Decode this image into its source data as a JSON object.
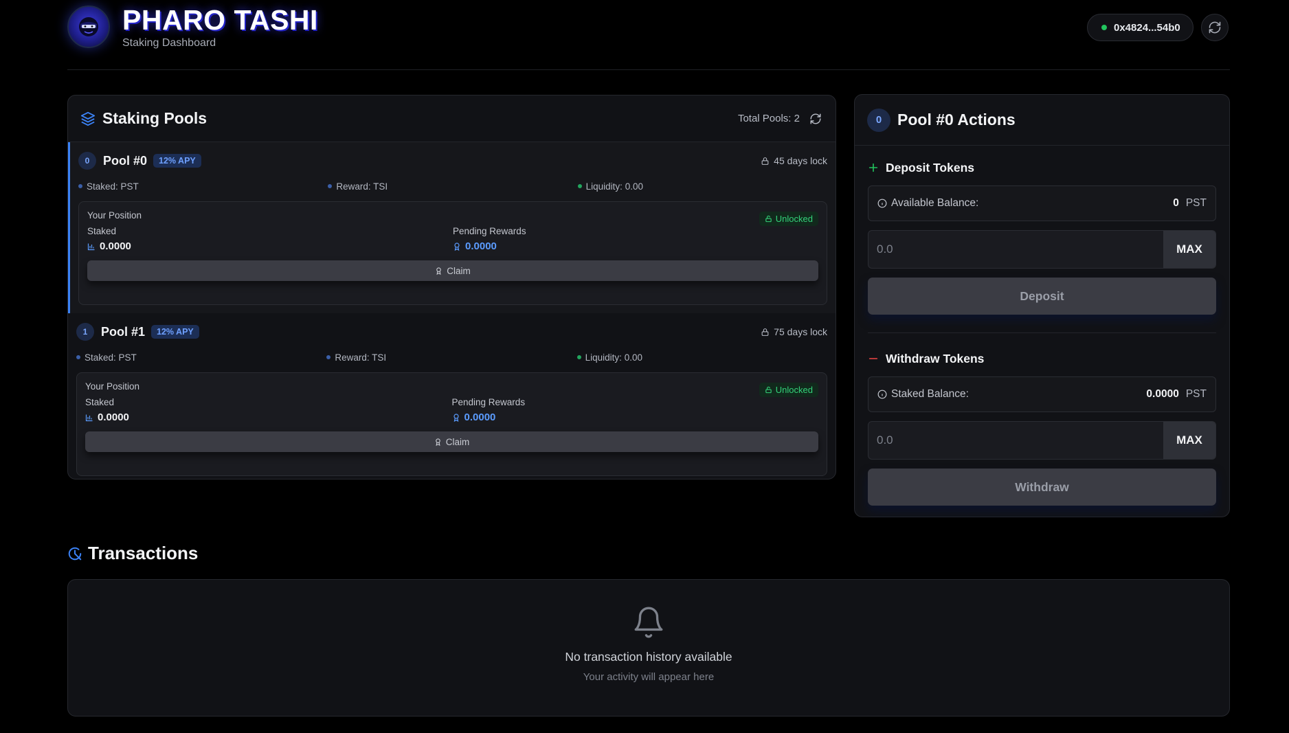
{
  "header": {
    "title": "PHARO TASHI",
    "subtitle": "Staking Dashboard",
    "wallet_address": "0x4824...54b0"
  },
  "pools_panel": {
    "title": "Staking Pools",
    "total_pools_label": "Total Pools: 2",
    "pools": [
      {
        "number": "0",
        "name": "Pool #0",
        "apy": "12% APY",
        "lock": "45 days lock",
        "staked_token": "Staked: PST",
        "reward_token": "Reward: TSI",
        "liquidity": "Liquidity: 0.00",
        "position_label": "Your Position",
        "status": "Unlocked",
        "staked_label": "Staked",
        "staked_value": "0.0000",
        "pending_label": "Pending Rewards",
        "pending_value": "0.0000",
        "claim_label": "Claim"
      },
      {
        "number": "1",
        "name": "Pool #1",
        "apy": "12% APY",
        "lock": "75 days lock",
        "staked_token": "Staked: PST",
        "reward_token": "Reward: TSI",
        "liquidity": "Liquidity: 0.00",
        "position_label": "Your Position",
        "status": "Unlocked",
        "staked_label": "Staked",
        "staked_value": "0.0000",
        "pending_label": "Pending Rewards",
        "pending_value": "0.0000",
        "claim_label": "Claim"
      }
    ]
  },
  "actions_panel": {
    "number": "0",
    "title": "Pool #0 Actions",
    "deposit": {
      "title": "Deposit Tokens",
      "balance_label": "Available Balance:",
      "balance_value": "0",
      "balance_unit": "PST",
      "placeholder": "0.0",
      "max_label": "MAX",
      "button_label": "Deposit"
    },
    "withdraw": {
      "title": "Withdraw Tokens",
      "balance_label": "Staked Balance:",
      "balance_value": "0.0000",
      "balance_unit": "PST",
      "placeholder": "0.0",
      "max_label": "MAX",
      "button_label": "Withdraw"
    }
  },
  "transactions": {
    "title": "Transactions",
    "empty_title": "No transaction history available",
    "empty_subtitle": "Your activity will appear here"
  },
  "colors": {
    "accent": "#3b82f6",
    "success": "#22c55e",
    "background": "#000000",
    "card": "#111216"
  }
}
